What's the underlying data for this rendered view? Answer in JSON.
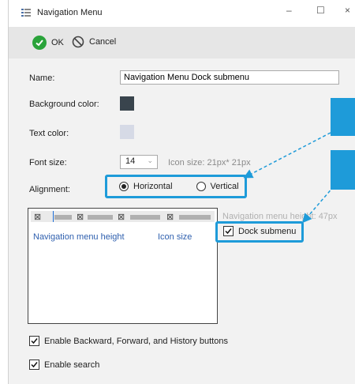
{
  "window": {
    "title": "Navigation Menu",
    "minimize": "–",
    "maximize": "☐",
    "close": "×"
  },
  "toolbar": {
    "ok_label": "OK",
    "cancel_label": "Cancel"
  },
  "form": {
    "name_label": "Name:",
    "name_value": "Navigation Menu Dock submenu",
    "bg_color_label": "Background color:",
    "bg_color": "#39444d",
    "text_color_label": "Text color:",
    "text_color": "#d6dae6",
    "font_size_label": "Font size:",
    "font_size_value": "14",
    "icon_size_hint": "Icon size: 21px* 21px",
    "alignment_label": "Alignment:",
    "alignment_options": [
      "Horizontal",
      "Vertical"
    ],
    "alignment_selected": "Horizontal",
    "nav_height_hint": "Navigation menu height: 47px",
    "dock_submenu_label": "Dock submenu",
    "dock_submenu_checked": true,
    "enable_history_label": "Enable Backward, Forward, and History buttons",
    "enable_history_checked": true,
    "enable_search_label": "Enable search",
    "enable_search_checked": true
  },
  "preview": {
    "nav_height_label": "Navigation menu height",
    "icon_size_label": "Icon size"
  },
  "colors": {
    "accent": "#1e9bd9",
    "ok_green": "#2aa33a"
  }
}
